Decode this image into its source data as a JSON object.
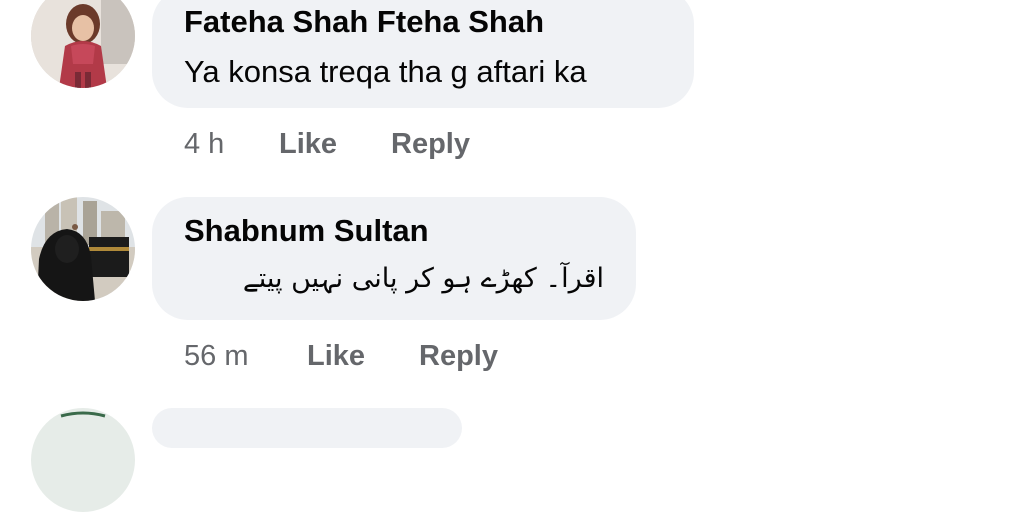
{
  "comments": [
    {
      "author": "Fateha Shah Fteha Shah",
      "text": "Ya konsa treqa tha g aftari ka",
      "time": "4 h",
      "like_label": "Like",
      "reply_label": "Reply"
    },
    {
      "author": "Shabnum Sultan",
      "text": "اقرآ۔ کھڑے ہو کر پانی نہیں پیتے",
      "time": "56 m",
      "like_label": "Like",
      "reply_label": "Reply"
    }
  ],
  "colors": {
    "bubble": "#f0f2f5",
    "meta_text": "#65676b",
    "name_text": "#050505"
  }
}
